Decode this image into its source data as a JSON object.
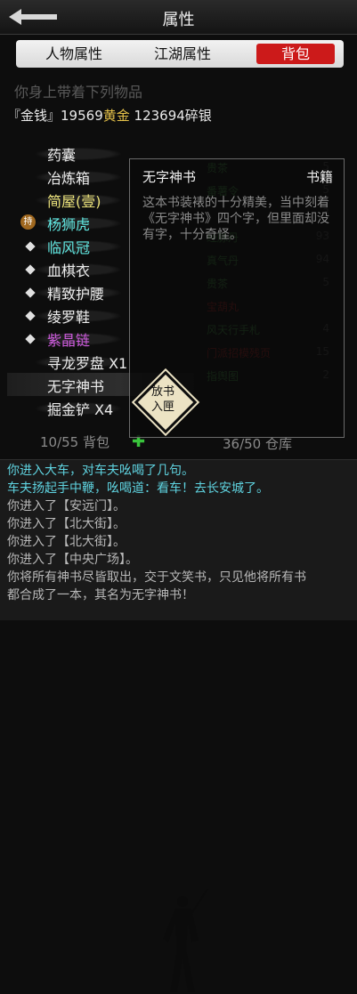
{
  "header": {
    "title": "属性"
  },
  "tabs": [
    {
      "label": "人物属性",
      "active": false
    },
    {
      "label": "江湖属性",
      "active": false
    },
    {
      "label": "背包",
      "active": true
    }
  ],
  "inventory_heading": "你身上带着下列物品",
  "money": {
    "prefix": "『金钱』",
    "gold_amount": "19569",
    "gold_label": "黄金",
    "silver_amount": "123694",
    "silver_label": "碎银"
  },
  "items": [
    {
      "label": "药囊",
      "color": "#ececec",
      "mark": "none"
    },
    {
      "label": "冶炼箱",
      "color": "#ececec",
      "mark": "none"
    },
    {
      "label": "简屋(壹)",
      "color": "#ece37a",
      "mark": "none"
    },
    {
      "label": "杨狮虎",
      "color": "#60e6e0",
      "mark": "hold",
      "hold_label": "持"
    },
    {
      "label": "临风冠",
      "color": "#60e6e0",
      "mark": "diamond"
    },
    {
      "label": "血棋衣",
      "color": "#ececec",
      "mark": "diamond"
    },
    {
      "label": "精致护腰",
      "color": "#ececec",
      "mark": "diamond"
    },
    {
      "label": "绫罗鞋",
      "color": "#ececec",
      "mark": "diamond"
    },
    {
      "label": "紫晶链",
      "color": "#d05ce0",
      "mark": "diamond"
    },
    {
      "label": "寻龙罗盘 X1",
      "color": "#ececec",
      "mark": "none"
    },
    {
      "label": "无字神书",
      "color": "#ececec",
      "mark": "none",
      "selected": true
    },
    {
      "label": "掘金铲 X4",
      "color": "#ececec",
      "mark": "none"
    }
  ],
  "bag_count": "10/55 背包",
  "storage_count": "36/50 仓库",
  "storage_list": [
    {
      "name": "贵茶",
      "qty": "5"
    },
    {
      "name": "番薯令",
      "qty": "5"
    },
    {
      "name": "",
      "qty": "3"
    },
    {
      "name": "经脉丹",
      "qty": "93"
    },
    {
      "name": "真气丹",
      "qty": "94"
    },
    {
      "name": "贵茶",
      "qty": "5"
    },
    {
      "name": "宝葫丸",
      "qty": ""
    },
    {
      "name": "风天行手札",
      "qty": "4"
    },
    {
      "name": "门派招模残页",
      "qty": "15"
    },
    {
      "name": "指舆图",
      "qty": "2"
    }
  ],
  "popup": {
    "title": "无字神书",
    "type": "书籍",
    "description": "这本书装裱的十分精美，当中刻着《无字神书》四个字，但里面却没有字，十分奇怪。",
    "store_button": [
      "放书",
      "入匣"
    ]
  },
  "log": [
    {
      "text": "你进入大车，对车夫吆喝了几句。",
      "color": "cyan"
    },
    {
      "text": "车夫扬起手中鞭，吆喝道：看车！去长安城了。",
      "color": "cyan"
    },
    {
      "text": "你进入了【安远门】。",
      "color": "gray"
    },
    {
      "text": "你进入了【北大街】。",
      "color": "gray"
    },
    {
      "text": "你进入了【北大街】。",
      "color": "gray"
    },
    {
      "text": "你进入了【中央广场】。",
      "color": "gray"
    },
    {
      "text": "你将所有神书尽皆取出，交于文笑书，只见他将所有书",
      "color": "gray"
    },
    {
      "text": "都合成了一本，其名为无字神书！",
      "color": "gray"
    }
  ]
}
